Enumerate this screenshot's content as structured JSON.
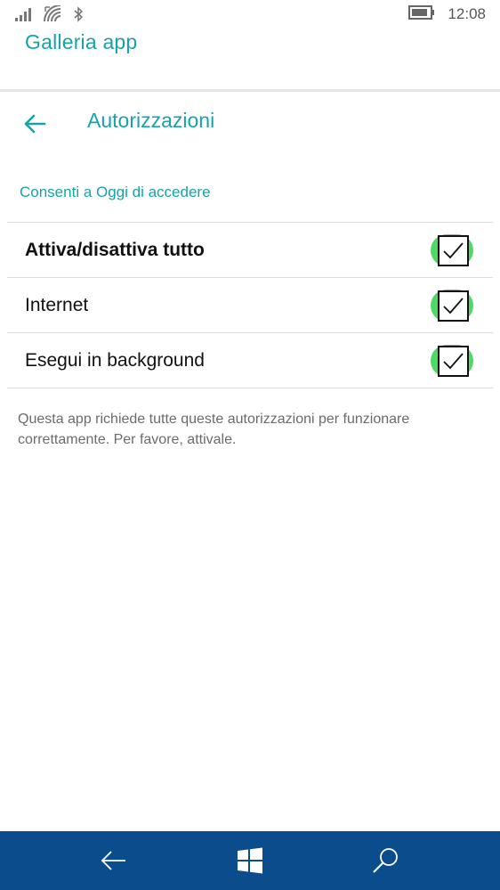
{
  "status_bar": {
    "time": "12:08",
    "icons": [
      "signal-icon",
      "wifi-icon",
      "bluetooth-icon",
      "battery-icon"
    ]
  },
  "app_title": "Galleria app",
  "page": {
    "title": "Autorizzazioni",
    "back_icon": "back-arrow-icon"
  },
  "section_label": "Consenti a Oggi di accedere",
  "permissions": [
    {
      "label": "Attiva/disattiva tutto",
      "checked": true,
      "bold": true
    },
    {
      "label": "Internet",
      "checked": true,
      "bold": false
    },
    {
      "label": "Esegui in background",
      "checked": true,
      "bold": false
    }
  ],
  "info_text": "Questa app richiede tutte queste autorizzazioni per funzionare correttamente. Per favore, attivale.",
  "nav_bar": {
    "buttons": [
      "back-icon",
      "windows-icon",
      "search-icon"
    ]
  },
  "colors": {
    "accent": "#17a3a8",
    "checkbox_ring": "#4cd964",
    "nav_bar": "#0b4d8c"
  }
}
